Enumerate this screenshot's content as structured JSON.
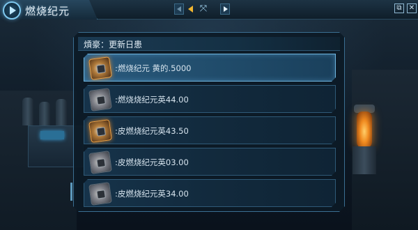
{
  "window": {
    "title": "燃烧纪元",
    "nav_expand_glyph": "⤧",
    "minimize_glyph": "⧉",
    "close_glyph": "✕"
  },
  "panel": {
    "title": "熕豪：更新日患"
  },
  "updates": [
    {
      "text": ":燃烧纪元 黄的.5000",
      "icon": "orange-gear-icon",
      "selected": true
    },
    {
      "text": ":燃烧烧纪元英44.00",
      "icon": "grey-gear-icon",
      "selected": false
    },
    {
      "text": ":皮燃烧纪元英43.50",
      "icon": "orange-gear-icon",
      "selected": false
    },
    {
      "text": ":皮燃烧纪元英03.00",
      "icon": "grey-gear-icon",
      "selected": false
    },
    {
      "text": ":皮燃烧纪元英34.00",
      "icon": "grey-gear-icon",
      "selected": false
    }
  ],
  "colors": {
    "accent": "#6fb6e0",
    "glow": "#f0a040"
  }
}
